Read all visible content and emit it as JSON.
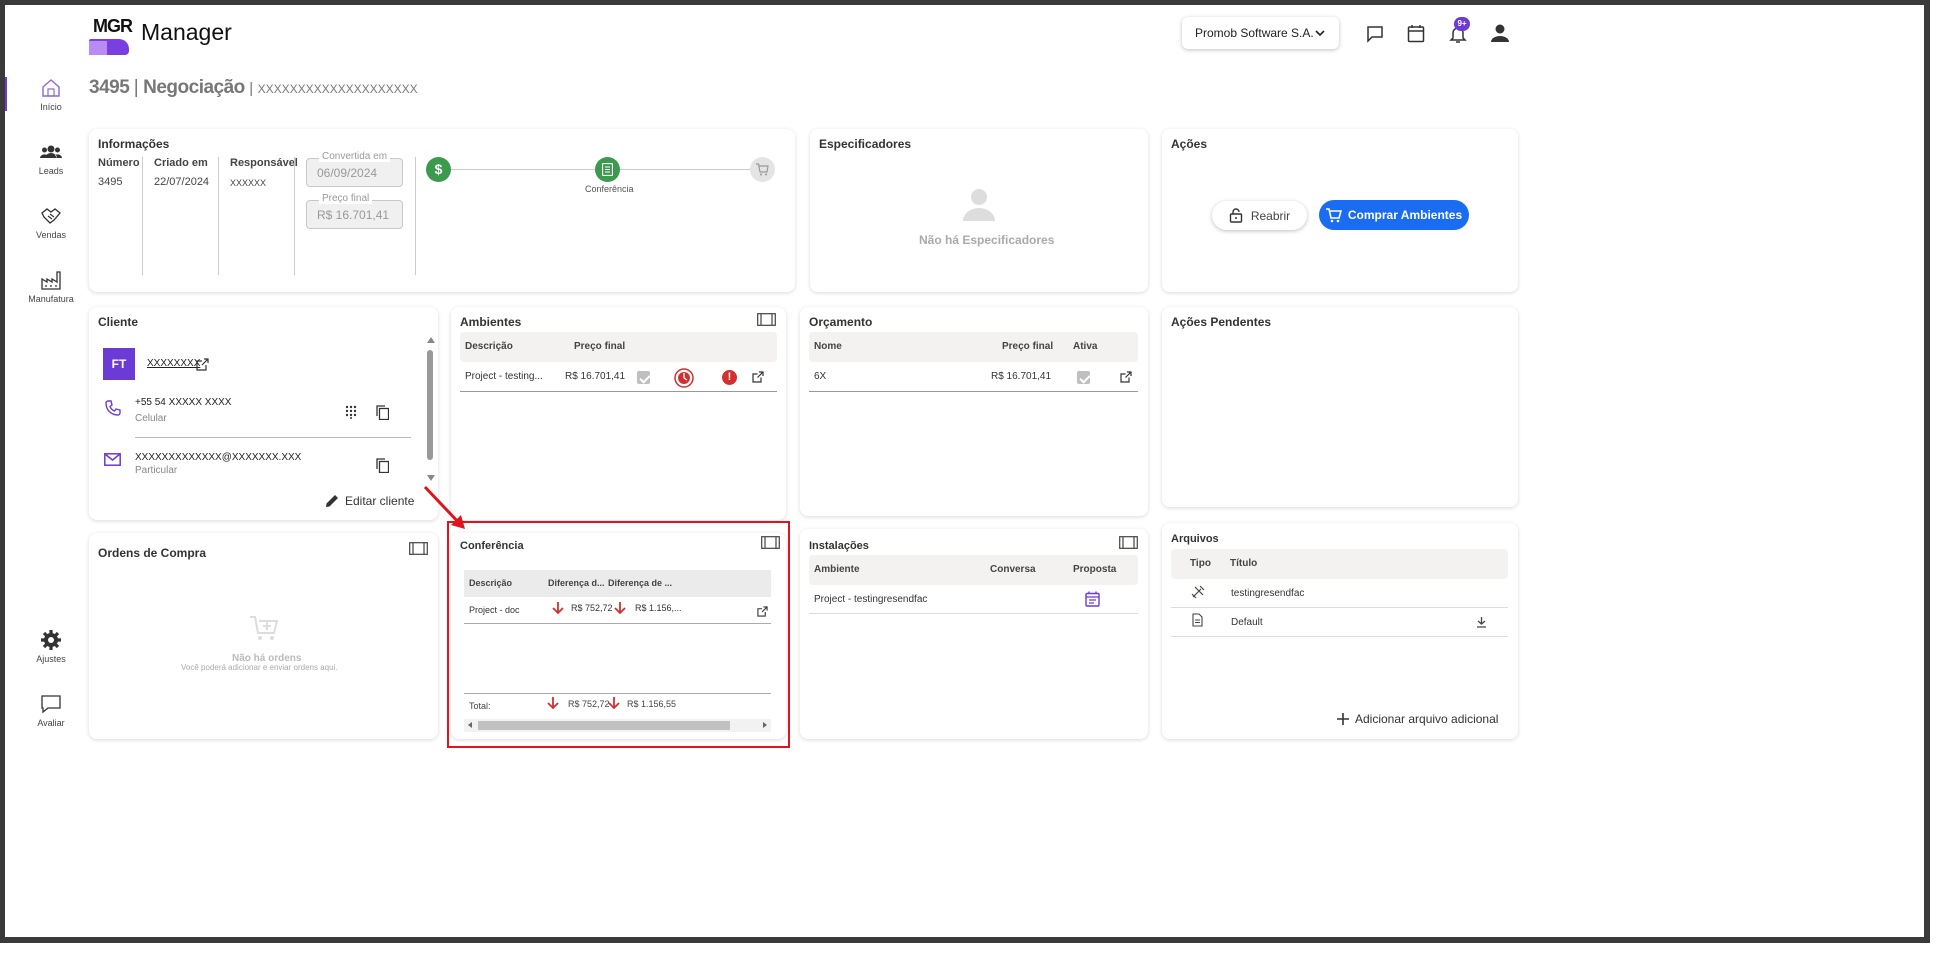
{
  "header": {
    "logo_text": "MGR",
    "app_title": "Manager",
    "company_selector": "Promob Software S.A.",
    "notification_badge": "9+"
  },
  "sidebar": {
    "items": [
      {
        "label": "Início"
      },
      {
        "label": "Leads"
      },
      {
        "label": "Vendas"
      },
      {
        "label": "Manufatura"
      },
      {
        "label": "Ajustes"
      },
      {
        "label": "Avaliar"
      }
    ]
  },
  "page": {
    "title_number": "3495",
    "title_sep": "|",
    "title_name": "Negociação",
    "title_sep2": "|",
    "title_client": "XXXXXXXXXXXXXXXXXXXX"
  },
  "informacoes": {
    "title": "Informações",
    "numero_label": "Número",
    "numero_value": "3495",
    "criado_label": "Criado em",
    "criado_value": "22/07/2024",
    "responsavel_label": "Responsável",
    "responsavel_value": "XXXXXX",
    "convertida_label": "Convertida em",
    "convertida_value": "06/09/2024",
    "preco_label": "Preço final",
    "preco_value": "R$ 16.701,41",
    "stepper_active_label": "Conferência"
  },
  "especificadores": {
    "title": "Especificadores",
    "empty_text": "Não há Especificadores"
  },
  "acoes": {
    "title": "Ações",
    "reabrir_label": "Reabrir",
    "comprar_label": "Comprar Ambientes"
  },
  "cliente": {
    "title": "Cliente",
    "avatar_initials": "FT",
    "name": "XXXXXXXX",
    "phone": "+55 54 XXXXX XXXX",
    "phone_type": "Celular",
    "email": "XXXXXXXXXXXXX@XXXXXXX.XXX",
    "email_type": "Particular",
    "edit_label": "Editar cliente"
  },
  "ambientes": {
    "title": "Ambientes",
    "col_descricao": "Descrição",
    "col_preco": "Preço final",
    "rows": [
      {
        "descricao": "Project - testing...",
        "preco": "R$ 16.701,41"
      }
    ]
  },
  "orcamento": {
    "title": "Orçamento",
    "col_nome": "Nome",
    "col_preco": "Preço final",
    "col_ativa": "Ativa",
    "rows": [
      {
        "nome": "6X",
        "preco": "R$ 16.701,41"
      }
    ]
  },
  "acoes_pendentes": {
    "title": "Ações Pendentes"
  },
  "ordens": {
    "title": "Ordens de Compra",
    "empty_title": "Não há ordens",
    "empty_sub": "Você poderá adicionar e enviar ordens aqui."
  },
  "conferencia": {
    "title": "Conferência",
    "col_descricao": "Descrição",
    "col_dif1": "Diferença d...",
    "col_dif2": "Diferença de ...",
    "rows": [
      {
        "descricao": "Project - doc",
        "dif1": "R$ 752,72",
        "dif2": "R$ 1.156,..."
      }
    ],
    "total_label": "Total:",
    "total_dif1": "R$ 752,72",
    "total_dif2": "R$ 1.156,55"
  },
  "instalacoes": {
    "title": "Instalações",
    "col_ambiente": "Ambiente",
    "col_conversa": "Conversa",
    "col_proposta": "Proposta",
    "rows": [
      {
        "ambiente": "Project - testingresendfac"
      }
    ]
  },
  "arquivos": {
    "title": "Arquivos",
    "col_tipo": "Tipo",
    "col_titulo": "Título",
    "rows": [
      {
        "titulo": "testingresendfac"
      },
      {
        "titulo": "Default"
      }
    ],
    "add_label": "Adicionar arquivo adicional"
  },
  "colors": {
    "accent": "#6c3ad4",
    "primary_button": "#1a6cf0",
    "success": "#3b9a4e",
    "danger": "#d32f2f",
    "annotation": "#e0141e"
  }
}
